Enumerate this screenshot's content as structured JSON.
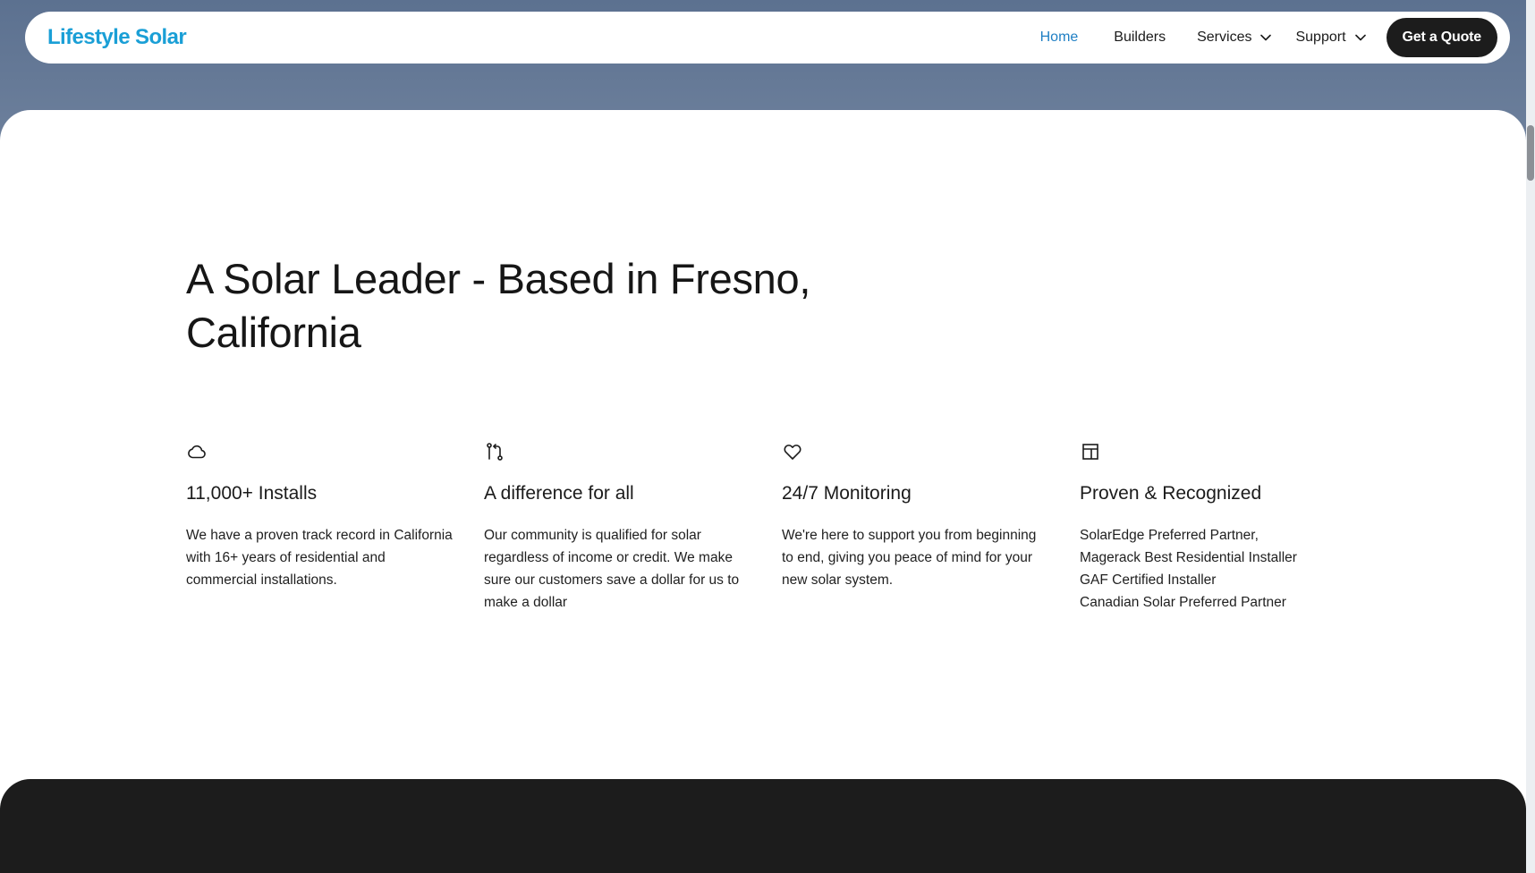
{
  "brand": {
    "name": "Lifestyle Solar",
    "color": "#1a9fd6"
  },
  "nav": {
    "items": [
      {
        "label": "Home",
        "active": true
      },
      {
        "label": "Builders",
        "active": false
      },
      {
        "label": "Services",
        "active": false,
        "icon": "chevron-down-icon"
      },
      {
        "label": "Support",
        "active": false,
        "icon": "chevron-down-icon"
      }
    ],
    "cta": "Get a Quote"
  },
  "main": {
    "heading": "A Solar Leader - Based in Fresno, California",
    "features": [
      {
        "icon": "cloud-icon",
        "title": "11,000+ Installs",
        "description": "We have a proven track record in California with 16+ years of residential and commercial installations."
      },
      {
        "icon": "git-compare-icon",
        "title": "A difference for all",
        "description": "Our community is qualified for solar regardless of income or credit. We make sure our customers save a dollar for us to make a dollar"
      },
      {
        "icon": "heart-icon",
        "title": "24/7 Monitoring",
        "description": "We're here to support you from beginning to end, giving you peace of mind for your new solar system."
      },
      {
        "icon": "layout-icon",
        "title": "Proven & Recognized",
        "lines": [
          "SolarEdge Preferred Partner,",
          "Magerack Best Residential Installer",
          "GAF Certified Installer",
          "Canadian Solar Preferred Partner"
        ]
      }
    ]
  },
  "colors": {
    "accent": "#1f7fc4",
    "dark": "#1c1c1c",
    "text": "#161616"
  }
}
